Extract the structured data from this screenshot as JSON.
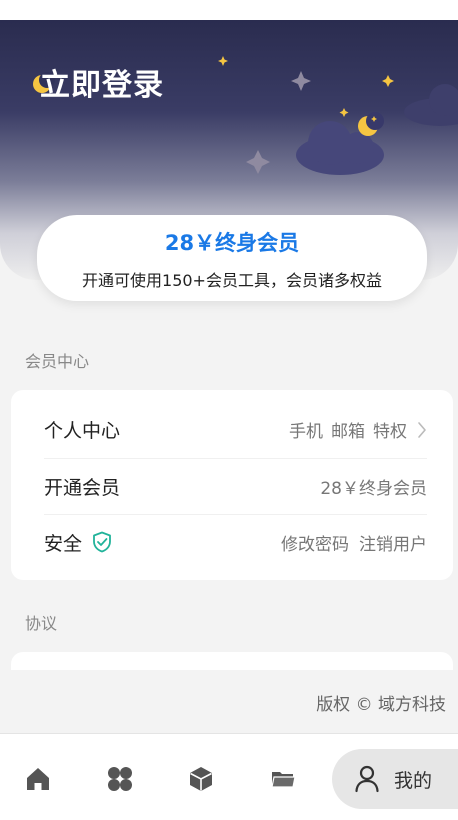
{
  "header": {
    "login_title": "立即登录"
  },
  "vip_card": {
    "title": "28￥终身会员",
    "description": "开通可使用150+会员工具，会员诸多权益"
  },
  "member_section": {
    "label": "会员中心",
    "rows": [
      {
        "title": "个人中心",
        "right": [
          "手机",
          "邮箱",
          "特权"
        ],
        "has_chevron": true
      },
      {
        "title": "开通会员",
        "right": [
          "28￥终身会员"
        ]
      },
      {
        "title": "安全",
        "right": [
          "修改密码",
          "注销用户"
        ],
        "badge_icon": "shield-check-icon"
      }
    ]
  },
  "agreement_section": {
    "label": "协议"
  },
  "copyright": "版权 © 域方科技",
  "tabbar": {
    "items": [
      {
        "icon": "home-icon"
      },
      {
        "icon": "apps-grid-icon"
      },
      {
        "icon": "cube-icon"
      },
      {
        "icon": "folder-icon"
      },
      {
        "icon": "user-icon",
        "label": "我的",
        "active": true
      }
    ]
  },
  "colors": {
    "accent": "#1a79e6",
    "shield": "#21b39a",
    "moon": "#f5c542"
  }
}
